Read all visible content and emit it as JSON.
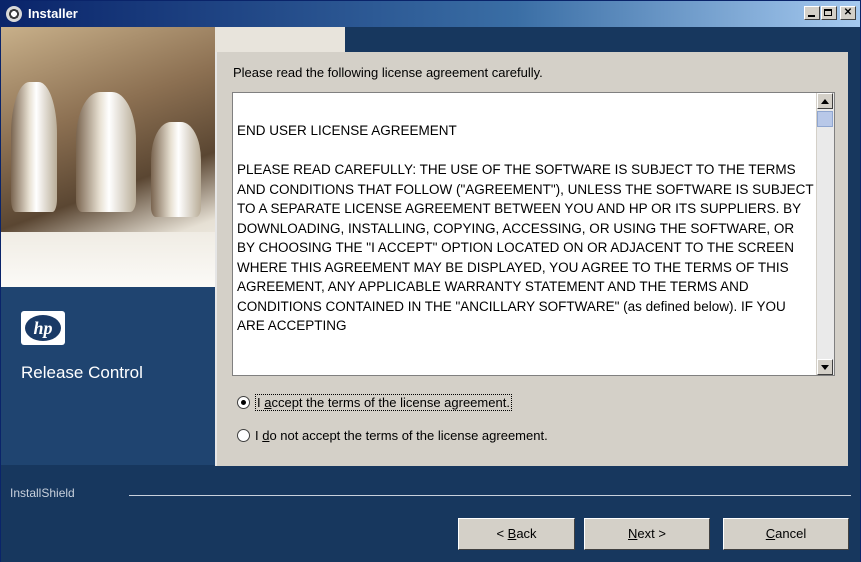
{
  "window": {
    "title": "Installer"
  },
  "sidebar": {
    "logo_text": "hp",
    "product_name": "Release Control"
  },
  "content": {
    "prompt": "Please read the following license agreement carefully.",
    "license_text": "END USER LICENSE AGREEMENT\n\nPLEASE READ CAREFULLY: THE USE OF THE SOFTWARE IS SUBJECT TO THE TERMS AND CONDITIONS THAT FOLLOW (\"AGREEMENT\"), UNLESS THE SOFTWARE IS SUBJECT TO A SEPARATE LICENSE AGREEMENT BETWEEN YOU AND HP OR ITS SUPPLIERS. BY DOWNLOADING, INSTALLING, COPYING, ACCESSING, OR USING THE SOFTWARE, OR BY CHOOSING THE \"I ACCEPT\" OPTION LOCATED ON OR ADJACENT TO THE SCREEN WHERE THIS AGREEMENT MAY BE DISPLAYED, YOU AGREE TO THE TERMS OF THIS AGREEMENT, ANY APPLICABLE WARRANTY STATEMENT AND THE TERMS AND CONDITIONS CONTAINED IN THE \"ANCILLARY SOFTWARE\" (as defined below). IF YOU ARE ACCEPTING",
    "accept_option": {
      "prefix": "I ",
      "mnemonic": "a",
      "rest": "ccept the terms of the license agreement.",
      "selected": true
    },
    "decline_option": {
      "prefix": "I ",
      "mnemonic": "d",
      "rest": "o not accept the terms of the license agreement.",
      "selected": false
    }
  },
  "footer": {
    "brand": "InstallShield",
    "back_button": {
      "prefix": "< ",
      "mnemonic": "B",
      "rest": "ack"
    },
    "next_button": {
      "prefix": "",
      "mnemonic": "N",
      "rest": "ext >"
    },
    "cancel_button": {
      "prefix": "",
      "mnemonic": "C",
      "rest": "ancel"
    }
  }
}
